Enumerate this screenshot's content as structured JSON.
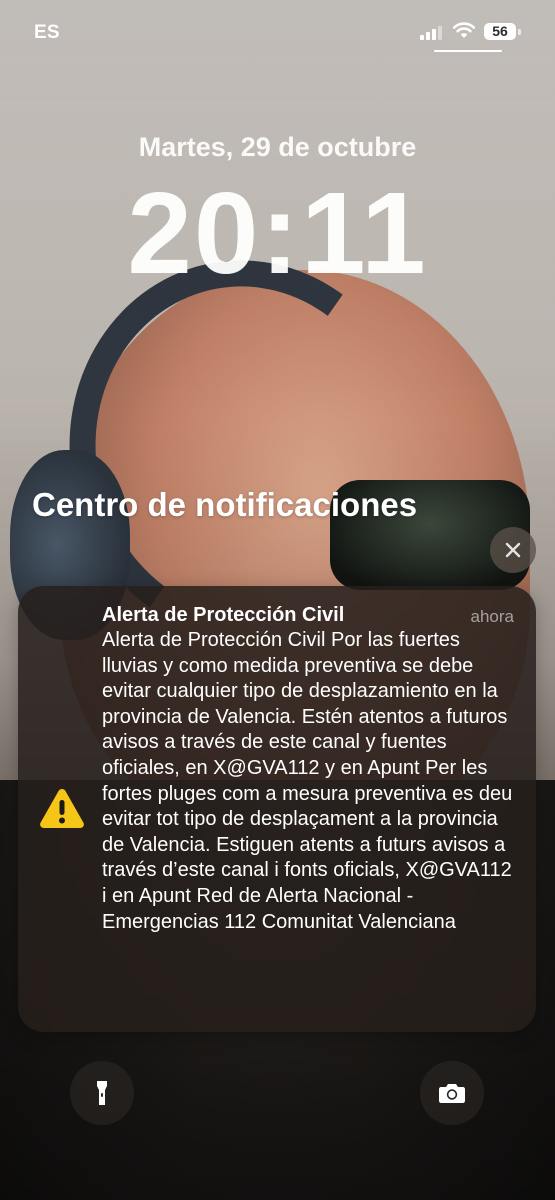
{
  "status_bar": {
    "carrier": "ES",
    "battery": "56",
    "signal_icon": "cellular-signal-icon",
    "wifi_icon": "wifi-icon"
  },
  "lock_screen": {
    "date": "Martes, 29 de octubre",
    "time": "20:11"
  },
  "notification_center": {
    "title": "Centro de notificaciones",
    "clear_icon": "close-icon"
  },
  "notification": {
    "icon": "warning-icon",
    "title": "Alerta de Protección Civil",
    "time": "ahora",
    "body": "Alerta de Protección Civil Por las fuertes lluvias y como medida preventiva se debe evitar cualquier tipo de desplazamiento en la provincia de Valencia. Estén atentos a futuros avisos a través de este canal y fuentes oficiales, en X@GVA112 y en Apunt Per les fortes pluges com a mesura preventiva es deu evitar tot tipo de desplaçament a la provincia de Valencia. Estiguen atents a futurs avisos a través d’este canal i fonts oficials, X@GVA112 i en Apunt Red de Alerta Nacional - Emergencias 112 Comunitat Valenciana",
    "accent_color": "#F5C518"
  },
  "quick_actions": {
    "left_icon": "flashlight-icon",
    "right_icon": "camera-icon"
  }
}
